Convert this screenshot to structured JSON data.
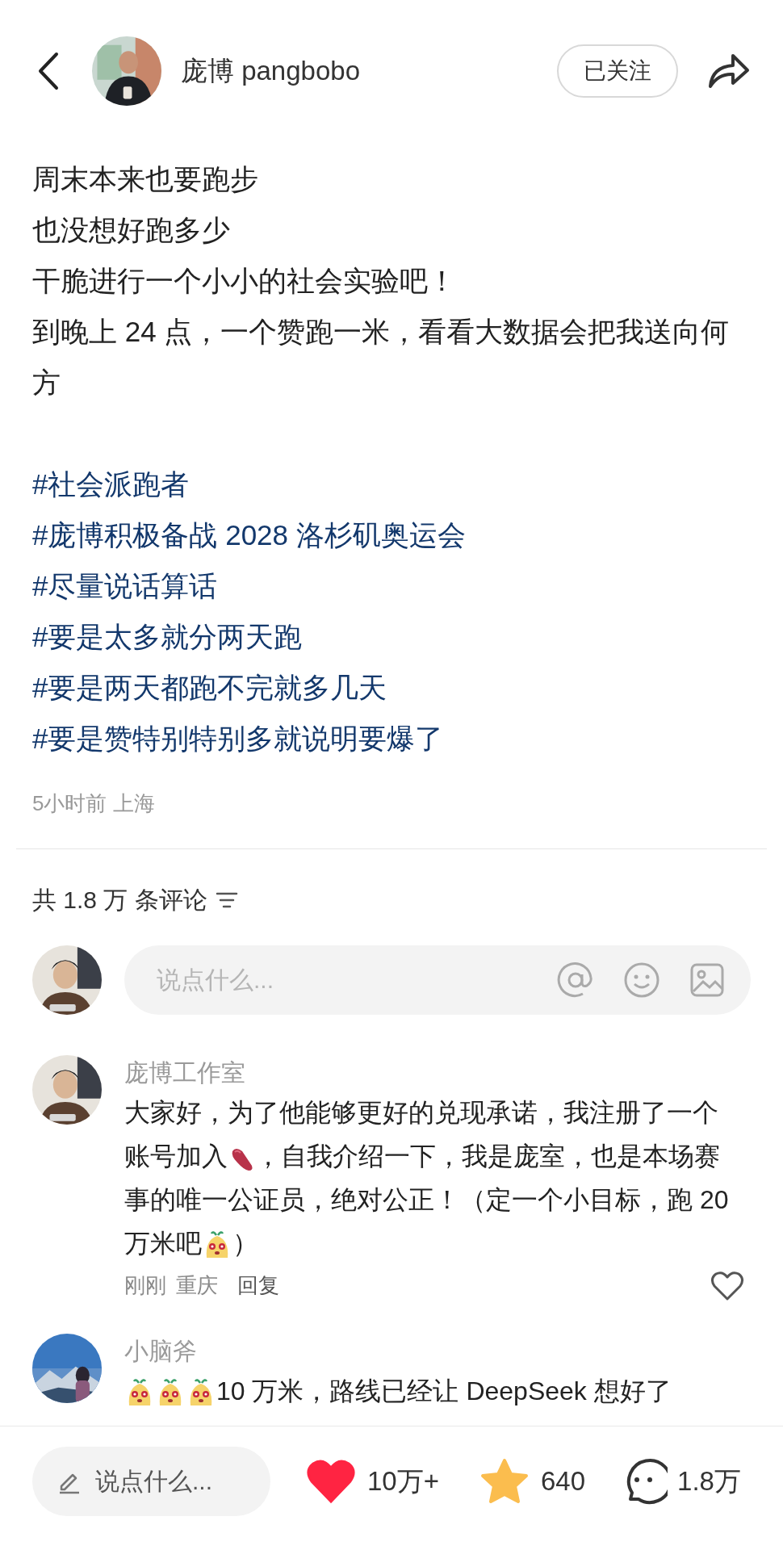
{
  "header": {
    "author": "庞博 pangbobo",
    "follow_button": "已关注"
  },
  "post": {
    "paragraphs": [
      "周末本来也要跑步",
      "也没想好跑多少",
      "干脆进行一个小小的社会实验吧！",
      "到晚上 24 点，一个赞跑一米，看看大数据会把我送向何方"
    ],
    "hashtags": [
      "#社会派跑者",
      "#庞博积极备战 2028 洛杉矶奥运会",
      "#尽量说话算话",
      "#要是太多就分两天跑",
      "#要是两天都跑不完就多几天",
      "#要是赞特别特别多就说明要爆了"
    ],
    "meta": "5小时前 上海"
  },
  "comments_header": {
    "count": "共 1.8 万 条评论"
  },
  "comment_input": {
    "placeholder": "说点什么..."
  },
  "comments": [
    {
      "author": "庞博工作室",
      "parts": [
        {
          "kind": "text",
          "text": "大家好，为了他能够更好的兑现承诺，我注册了一个账号加入"
        },
        {
          "kind": "potato"
        },
        {
          "kind": "text",
          "text": "，自我介绍一下，我是庞室，也是本场赛事的唯一公证员，绝对公正！（定一个小目标，跑 20万米吧"
        },
        {
          "kind": "mascot"
        },
        {
          "kind": "text",
          "text": "）"
        }
      ],
      "time": "刚刚",
      "location": "重庆",
      "reply": "回复",
      "liked": false
    },
    {
      "author": "小脑斧",
      "parts": [
        {
          "kind": "mascot"
        },
        {
          "kind": "mascot"
        },
        {
          "kind": "mascot"
        },
        {
          "kind": "text",
          "text": "10 万米，路线已经让 DeepSeek 想好了"
        }
      ]
    }
  ],
  "bottom_bar": {
    "placeholder": "说点什么...",
    "likes": "10万+",
    "liked": true,
    "favorites": "640",
    "favorited": true,
    "comments": "1.8万"
  }
}
